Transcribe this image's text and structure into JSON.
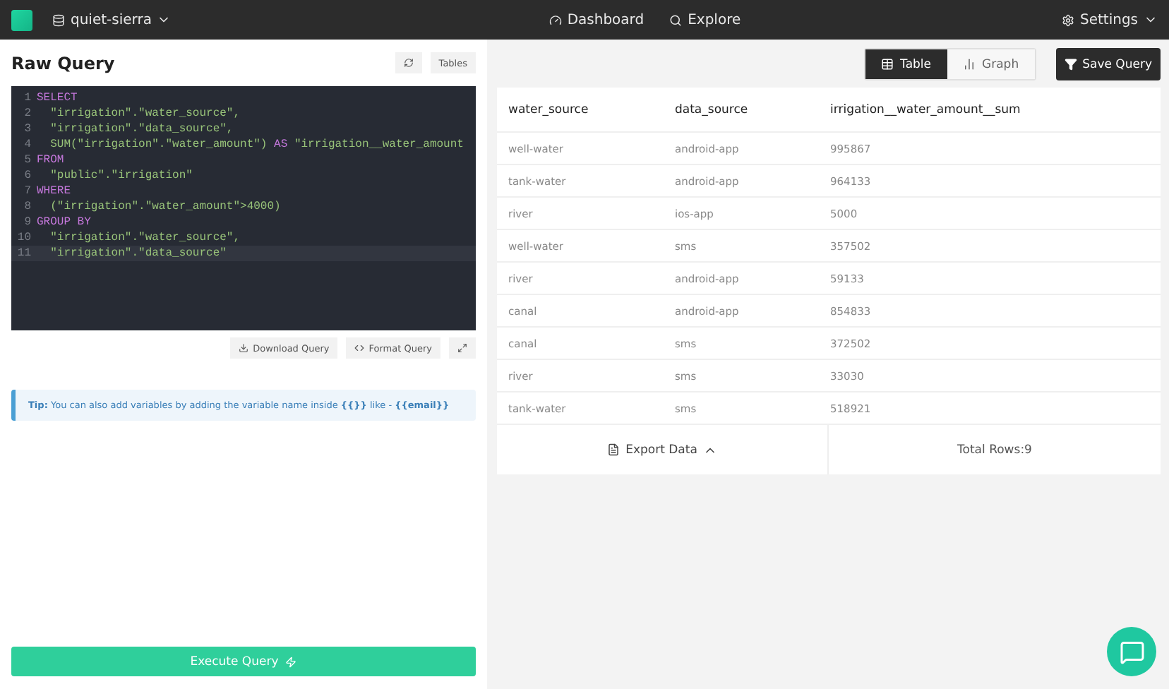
{
  "topbar": {
    "database": "quiet-sierra",
    "nav": [
      {
        "label": "Dashboard",
        "kind": "dashboard"
      },
      {
        "label": "Explore",
        "kind": "explore"
      }
    ],
    "settings": "Settings"
  },
  "query_panel": {
    "title": "Raw Query",
    "tables_button": "Tables",
    "code_lines": [
      {
        "number": "1",
        "active": false,
        "tokens": [
          {
            "kind": "keyword",
            "text": "SELECT"
          }
        ]
      },
      {
        "number": "2",
        "active": false,
        "tokens": [
          {
            "kind": "string",
            "text": "  \"irrigation\".\"water_source\","
          }
        ]
      },
      {
        "number": "3",
        "active": false,
        "tokens": [
          {
            "kind": "string",
            "text": "  \"irrigation\".\"data_source\","
          }
        ]
      },
      {
        "number": "4",
        "active": false,
        "tokens": [
          {
            "kind": "string",
            "text": "  SUM(\"irrigation\".\"water_amount\") "
          },
          {
            "kind": "keyword",
            "text": "AS"
          },
          {
            "kind": "string",
            "text": " \"irrigation__water_amount"
          }
        ]
      },
      {
        "number": "5",
        "active": false,
        "tokens": [
          {
            "kind": "keyword",
            "text": "FROM"
          }
        ]
      },
      {
        "number": "6",
        "active": false,
        "tokens": [
          {
            "kind": "string",
            "text": "  \"public\".\"irrigation\""
          }
        ]
      },
      {
        "number": "7",
        "active": false,
        "tokens": [
          {
            "kind": "keyword",
            "text": "WHERE"
          }
        ]
      },
      {
        "number": "8",
        "active": false,
        "tokens": [
          {
            "kind": "string",
            "text": "  (\"irrigation\".\"water_amount\">4000)"
          }
        ]
      },
      {
        "number": "9",
        "active": false,
        "tokens": [
          {
            "kind": "keyword",
            "text": "GROUP BY"
          }
        ]
      },
      {
        "number": "10",
        "active": false,
        "tokens": [
          {
            "kind": "string",
            "text": "  \"irrigation\".\"water_source\","
          }
        ]
      },
      {
        "number": "11",
        "active": true,
        "tokens": [
          {
            "kind": "string",
            "text": "  \"irrigation\".\"data_source\""
          }
        ]
      }
    ],
    "download_button": "Download Query",
    "format_button": "Format Query",
    "tip": "**Tip:** You can also add variables by adding the variable name inside **{{}}** like - **{{email}}**",
    "execute_button": "Execute Query"
  },
  "results": {
    "view_tabs": [
      {
        "label": "Table",
        "kind": "table",
        "selected": true
      },
      {
        "label": "Graph",
        "kind": "graph",
        "selected": false
      }
    ],
    "save_button": "Save Query",
    "columns": [
      "water_source",
      "data_source",
      "irrigation__water_amount__sum"
    ],
    "rows": [
      [
        "well-water",
        "android-app",
        "995867"
      ],
      [
        "tank-water",
        "android-app",
        "964133"
      ],
      [
        "river",
        "ios-app",
        "5000"
      ],
      [
        "well-water",
        "sms",
        "357502"
      ],
      [
        "river",
        "android-app",
        "59133"
      ],
      [
        "canal",
        "android-app",
        "854833"
      ],
      [
        "canal",
        "sms",
        "372502"
      ],
      [
        "river",
        "sms",
        "33030"
      ],
      [
        "tank-water",
        "sms",
        "518921"
      ]
    ],
    "export_button": "Export Data",
    "total_rows": "Total Rows:9"
  }
}
